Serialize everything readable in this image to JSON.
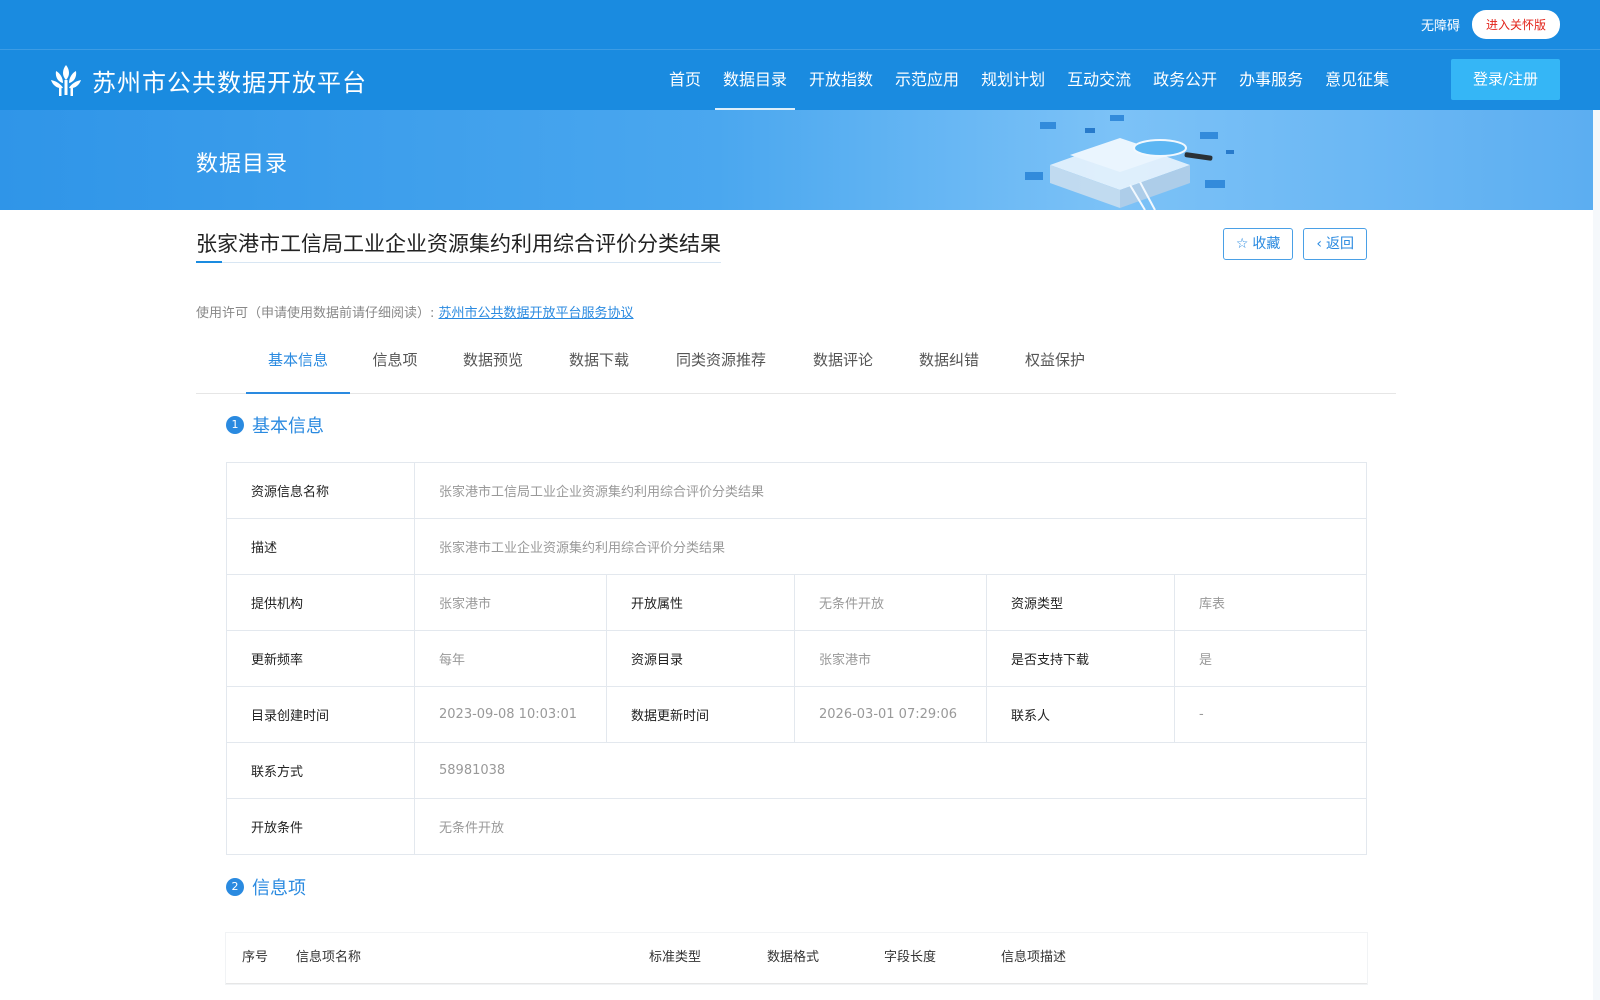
{
  "topbar": {
    "accessibility": "无障碍",
    "care_version": "进入关怀版"
  },
  "header": {
    "logo_text": "苏州市公共数据开放平台",
    "nav": [
      "首页",
      "数据目录",
      "开放指数",
      "示范应用",
      "规划计划",
      "互动交流",
      "政务公开",
      "办事服务",
      "意见征集"
    ],
    "active_nav": "数据目录",
    "login": "登录/注册"
  },
  "banner": {
    "title": "数据目录"
  },
  "dataset": {
    "title": "张家港市工信局工业企业资源集约利用综合评价分类结果",
    "favorite": "收藏",
    "back": "返回",
    "license_label": "使用许可（申请使用数据前请仔细阅读）:",
    "license_link": "苏州市公共数据开放平台服务协议"
  },
  "tabs": [
    "基本信息",
    "信息项",
    "数据预览",
    "数据下载",
    "同类资源推荐",
    "数据评论",
    "数据纠错",
    "权益保护"
  ],
  "basic_info": {
    "section_number": "1",
    "section_title": "基本信息",
    "resource_name_label": "资源信息名称",
    "resource_name": "张家港市工信局工业企业资源集约利用综合评价分类结果",
    "description_label": "描述",
    "description": "张家港市工业企业资源集约利用综合评价分类结果",
    "provider_label": "提供机构",
    "provider": "张家港市",
    "open_attr_label": "开放属性",
    "open_attr": "无条件开放",
    "resource_type_label": "资源类型",
    "resource_type": "库表",
    "frequency_label": "更新频率",
    "frequency": "每年",
    "catalog_label": "资源目录",
    "catalog": "张家港市",
    "download_label": "是否支持下载",
    "download": "是",
    "created_label": "目录创建时间",
    "created": "2023-09-08 10:03:01",
    "updated_label": "数据更新时间",
    "updated": "2026-03-01 07:29:06",
    "contact_label": "联系人",
    "contact": "-",
    "contact_method_label": "联系方式",
    "contact_method": "58981038",
    "open_condition_label": "开放条件",
    "open_condition": "无条件开放"
  },
  "info_items": {
    "section_number": "2",
    "section_title": "信息项",
    "columns": [
      "序号",
      "信息项名称",
      "标准类型",
      "数据格式",
      "字段长度",
      "信息项描述"
    ]
  },
  "colors": {
    "primary": "#1a8be0",
    "accent": "#2a8ae0",
    "login_button": "#35b6f6",
    "care_text": "#e2231a"
  }
}
